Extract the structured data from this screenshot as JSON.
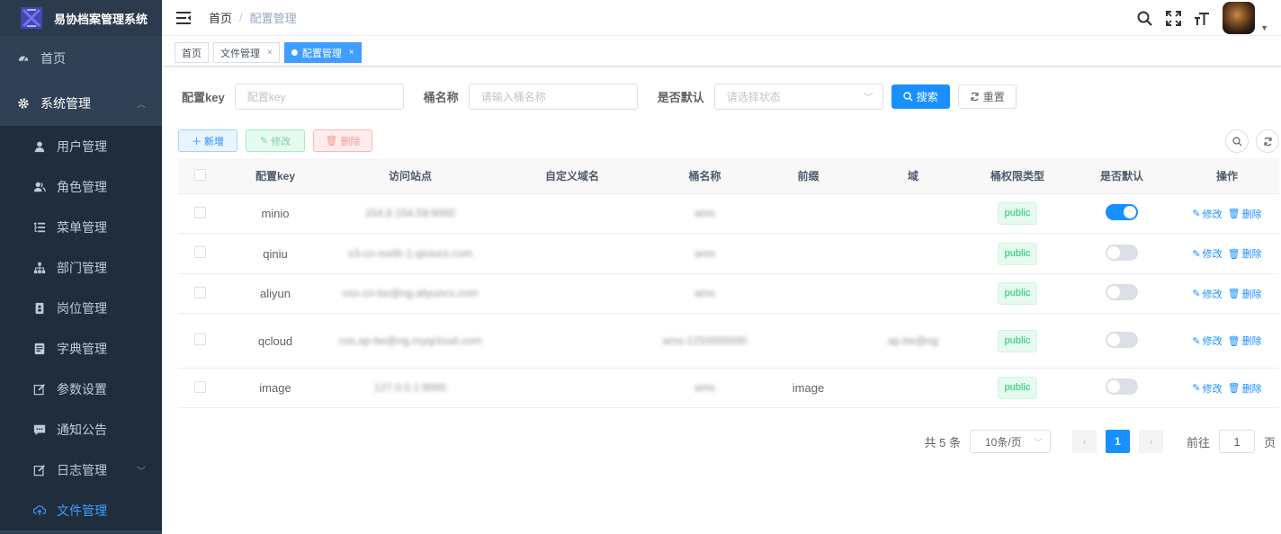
{
  "app": {
    "title": "易协档案管理系统"
  },
  "sidebar": {
    "home": "首页",
    "system": "系统管理",
    "items": [
      {
        "label": "用户管理",
        "icon": "user-icon"
      },
      {
        "label": "角色管理",
        "icon": "peoples-icon"
      },
      {
        "label": "菜单管理",
        "icon": "tree-table-icon"
      },
      {
        "label": "部门管理",
        "icon": "tree-icon"
      },
      {
        "label": "岗位管理",
        "icon": "post-icon"
      },
      {
        "label": "字典管理",
        "icon": "dict-icon"
      },
      {
        "label": "参数设置",
        "icon": "edit-icon"
      },
      {
        "label": "通知公告",
        "icon": "message-icon"
      },
      {
        "label": "日志管理",
        "icon": "log-icon"
      },
      {
        "label": "文件管理",
        "icon": "upload-icon"
      }
    ]
  },
  "header": {
    "breadcrumb_home": "首页",
    "breadcrumb_sep": "/",
    "breadcrumb_current": "配置管理"
  },
  "tags": [
    {
      "label": "首页"
    },
    {
      "label": "文件管理",
      "close": "×"
    },
    {
      "label": "配置管理",
      "close": "×"
    }
  ],
  "search": {
    "key_label": "配置key",
    "key_placeholder": "配置key",
    "bucket_label": "桶名称",
    "bucket_placeholder": "请输入桶名称",
    "default_label": "是否默认",
    "default_placeholder": "请选择状态",
    "search_btn": "搜索",
    "reset_btn": "重置"
  },
  "toolbar": {
    "add": "新增",
    "edit": "修改",
    "delete": "删除"
  },
  "table": {
    "headers": [
      "配置key",
      "访问站点",
      "自定义域名",
      "桶名称",
      "前缀",
      "域",
      "桶权限类型",
      "是否默认",
      "操作"
    ],
    "rows": [
      {
        "key": "minio",
        "endpoint": "154.8.154.59:9000",
        "domain": "",
        "bucket": "ams",
        "prefix": "",
        "region": "",
        "access": "public",
        "default": true
      },
      {
        "key": "qiniu",
        "endpoint": "s3-cn-north-1.qiniucs.com",
        "domain": "",
        "bucket": "ams",
        "prefix": "",
        "region": "",
        "access": "public",
        "default": false
      },
      {
        "key": "aliyun",
        "endpoint": "oss-cn-be@ng.aliyuncs.com",
        "domain": "",
        "bucket": "ams",
        "prefix": "",
        "region": "",
        "access": "public",
        "default": false
      },
      {
        "key": "qcloud",
        "endpoint": "cos.ap-be@ng.myqcloud.com",
        "domain": "",
        "bucket": "ams-1250000000",
        "prefix": "",
        "region": "ap-be@ng",
        "access": "public",
        "default": false
      },
      {
        "key": "image",
        "endpoint": "127.0.0.1:9000",
        "domain": "",
        "bucket": "ams",
        "prefix": "image",
        "region": "",
        "access": "public",
        "default": false
      }
    ],
    "op_edit": "修改",
    "op_delete": "删除"
  },
  "pagination": {
    "total": "共 5 条",
    "page_size": "10条/页",
    "current": "1",
    "goto_label": "前往",
    "goto_value": "1",
    "page_unit": "页"
  },
  "colors": {
    "sidebar": "#304156",
    "primary": "#1890ff",
    "active_tag": "#409eff"
  }
}
